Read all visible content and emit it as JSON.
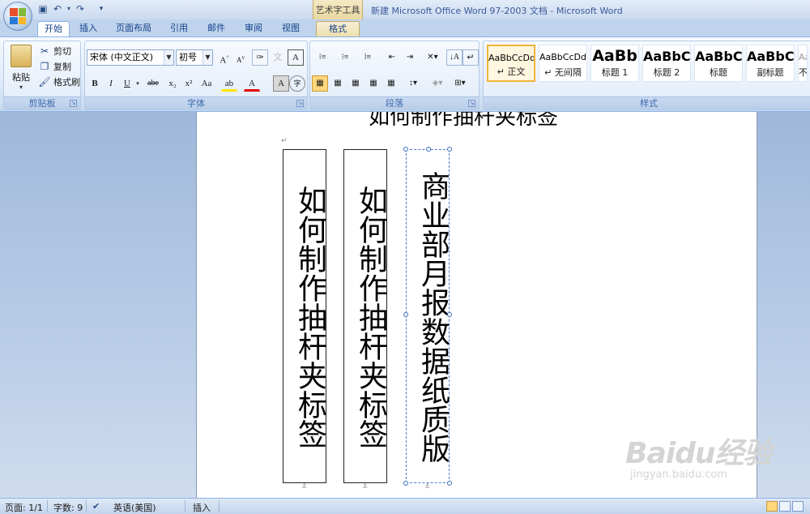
{
  "window": {
    "title": "新建 Microsoft Office Word 97-2003 文档 - Microsoft Word",
    "context_tab_group": "艺术字工具"
  },
  "tabs": [
    {
      "label": "开始",
      "active": true
    },
    {
      "label": "插入"
    },
    {
      "label": "页面布局"
    },
    {
      "label": "引用"
    },
    {
      "label": "邮件"
    },
    {
      "label": "审阅"
    },
    {
      "label": "视图"
    },
    {
      "label": "格式",
      "contextual": true
    }
  ],
  "clipboard": {
    "paste_label": "粘贴",
    "cut_label": "剪切",
    "copy_label": "复制",
    "format_painter_label": "格式刷",
    "group_label": "剪贴板"
  },
  "font": {
    "font_name": "宋体 (中文正文)",
    "font_size": "初号",
    "group_label": "字体",
    "buttons": [
      "B",
      "I",
      "U",
      "abe",
      "x₂",
      "x²",
      "Aa"
    ]
  },
  "paragraph": {
    "group_label": "段落"
  },
  "styles": {
    "group_label": "样式",
    "items": [
      {
        "sample": "AaBbCcDd",
        "name": "↵ 正文",
        "selected": true
      },
      {
        "sample": "AaBbCcDd",
        "name": "↵ 无间隔"
      },
      {
        "sample": "AaBb",
        "name": "标题 1"
      },
      {
        "sample": "AaBbC",
        "name": "标题 2"
      },
      {
        "sample": "AaBbC",
        "name": "标题"
      },
      {
        "sample": "AaBbC",
        "name": "副标题"
      },
      {
        "sample": "AaBbCcDd",
        "name": "不明"
      }
    ]
  },
  "document": {
    "top_text": "如何制作抽杆夹标签",
    "boxes": [
      {
        "text": "如何制作抽杆夹标签"
      },
      {
        "text": "如何制作抽杆夹标签"
      },
      {
        "text": "商业部月报数据纸质版",
        "selected": true
      }
    ]
  },
  "status": {
    "page": "页面: 1/1",
    "words": "字数: 9",
    "language": "英语(美国)",
    "mode": "插入"
  },
  "watermark": {
    "logo": "Baidu经验",
    "url": "jingyan.baidu.com"
  }
}
